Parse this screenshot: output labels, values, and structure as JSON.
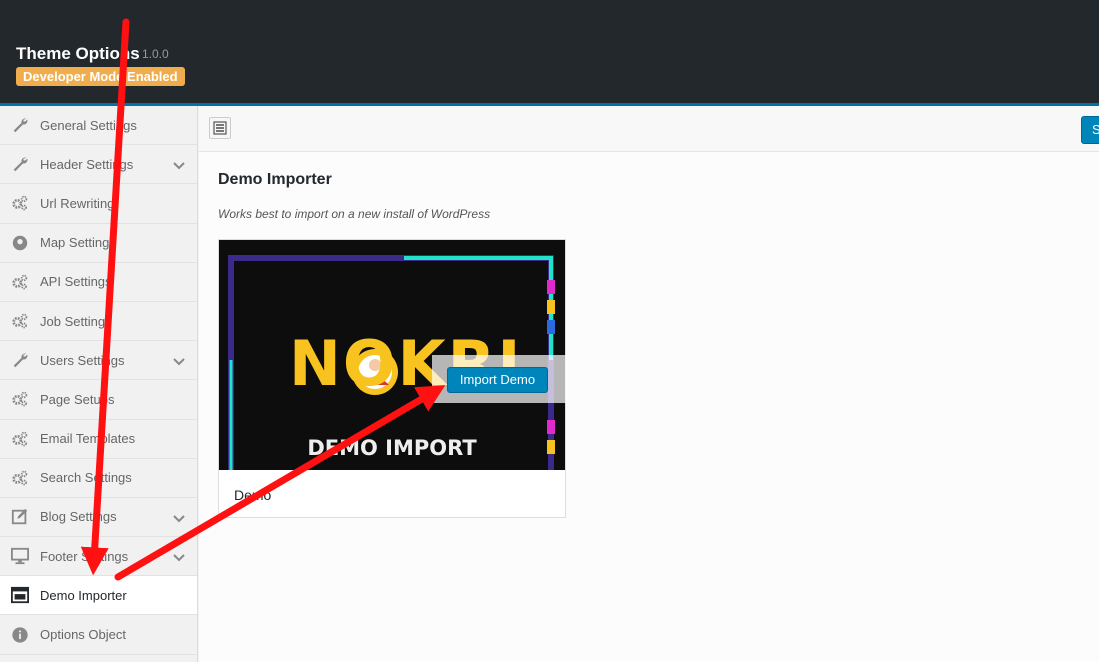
{
  "header": {
    "title": "Theme Options",
    "version": "1.0.0",
    "dev_badge": "Developer Mode Enabled"
  },
  "sidebar": {
    "items": [
      {
        "label": "General Settings",
        "icon": "wrench-icon",
        "has_children": false
      },
      {
        "label": "Header Settings",
        "icon": "wrench-icon",
        "has_children": true
      },
      {
        "label": "Url Rewriting",
        "icon": "gears-icon",
        "has_children": false
      },
      {
        "label": "Map Settings",
        "icon": "map-pin-icon",
        "has_children": false
      },
      {
        "label": "API Settings",
        "icon": "gears-icon",
        "has_children": false
      },
      {
        "label": "Job Settings",
        "icon": "gears-icon",
        "has_children": false
      },
      {
        "label": "Users Settings",
        "icon": "wrench-icon",
        "has_children": true
      },
      {
        "label": "Page Setups",
        "icon": "gears-icon",
        "has_children": false
      },
      {
        "label": "Email Templates",
        "icon": "gears-icon",
        "has_children": false
      },
      {
        "label": "Search Settings",
        "icon": "gears-icon",
        "has_children": false
      },
      {
        "label": "Blog Settings",
        "icon": "edit-icon",
        "has_children": true
      },
      {
        "label": "Footer Settings",
        "icon": "monitor-icon",
        "has_children": true
      },
      {
        "label": "Demo Importer",
        "icon": "window-icon",
        "has_children": false,
        "active": true
      },
      {
        "label": "Options Object",
        "icon": "info-icon",
        "has_children": false
      }
    ]
  },
  "toolbar": {
    "save_label": "Save Changes"
  },
  "main": {
    "section_title": "Demo Importer",
    "section_desc": "Works best to import on a new install of WordPress",
    "demo": {
      "name": "Demo",
      "thumb_brand": "NOKRI",
      "thumb_caption": "DEMO IMPORT",
      "import_label": "Import Demo"
    }
  },
  "colors": {
    "header_bg": "#23282d",
    "accent_blue": "#0085ba",
    "badge_orange": "#f0ad4e",
    "annotation_red": "#ff0000",
    "brand_yellow": "#f9c31f"
  }
}
